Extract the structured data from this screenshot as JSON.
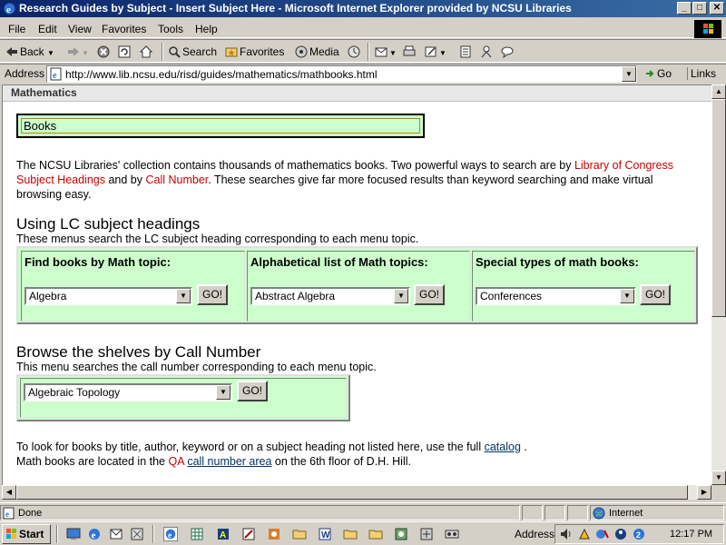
{
  "window": {
    "title": "Research Guides by Subject - Insert Subject Here - Microsoft Internet Explorer provided by NCSU Libraries",
    "min": "_",
    "max": "□",
    "close": "✕"
  },
  "menu": [
    "File",
    "Edit",
    "View",
    "Favorites",
    "Tools",
    "Help"
  ],
  "toolbar": {
    "back": "Back",
    "search": "Search",
    "favorites": "Favorites",
    "media": "Media"
  },
  "address": {
    "label": "Address",
    "url": "http://www.lib.ncsu.edu/risd/guides/mathematics/mathbooks.html",
    "go": "Go",
    "links": "Links"
  },
  "page": {
    "header": "Mathematics",
    "books_label": "Books",
    "intro": {
      "p1": "The NCSU Libraries' collection contains thousands of mathematics books. Two powerful ways to search are by ",
      "link1": "Library of Congress Subject Headings",
      "p2": " and by ",
      "link2": "Call Number",
      "p3": ". These searches give far more focused results than keyword searching and make virtual browsing easy."
    },
    "lc_heading": "Using LC subject headings",
    "lc_desc": "These menus search the LC subject heading corresponding to each menu topic.",
    "lc_cells": [
      {
        "title": "Find books by Math topic:",
        "selected": "Algebra",
        "go": "GO!"
      },
      {
        "title": "Alphabetical list of Math topics:",
        "selected": "Abstract Algebra",
        "go": "GO!"
      },
      {
        "title": "Special types of math books:",
        "selected": "Conferences",
        "go": "GO!"
      }
    ],
    "cn_heading": "Browse the shelves by Call Number",
    "cn_desc": "This menu searches the call number corresponding to each menu topic.",
    "cn_selected": "Algebraic Topology",
    "cn_go": "GO!",
    "footer": {
      "f1": "To look for books by title, author, keyword or on a subject heading not listed here, use the full ",
      "catalog": "catalog",
      "f1end": " .",
      "f2": "Math books are located in the ",
      "qa": "QA",
      "space": " ",
      "call_area": "call number area",
      "f2end": " on the 6th floor of D.H. Hill."
    }
  },
  "status": {
    "text": "Done",
    "zone": "Internet"
  },
  "taskbar": {
    "start": "Start",
    "address": "Address",
    "clock": "12:17 PM"
  }
}
